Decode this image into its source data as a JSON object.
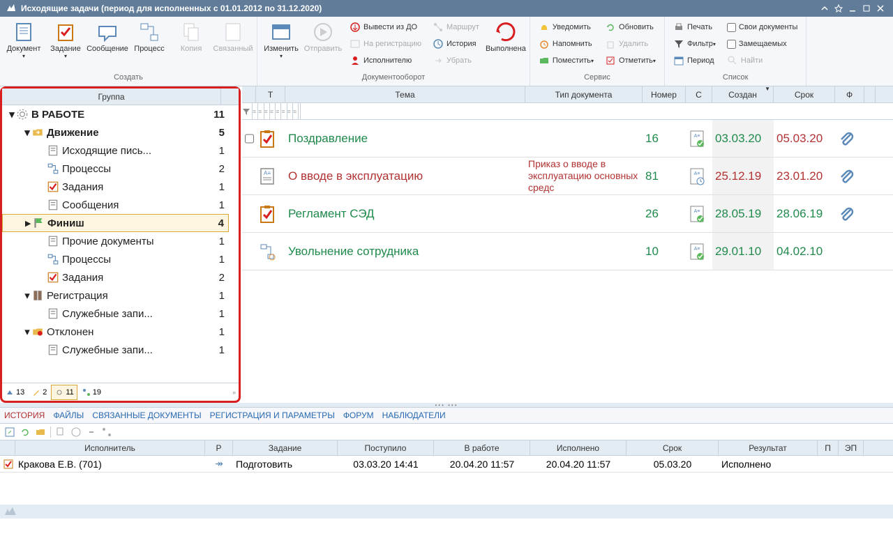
{
  "titlebar": {
    "title": "Исходящие задачи (период для исполненных с 01.01.2012 по 31.12.2020)"
  },
  "ribbon": {
    "group_create_label": "Создать",
    "group_docflow_label": "Документооборот",
    "group_service_label": "Сервис",
    "group_list_label": "Список",
    "document": "Документ",
    "task": "Задание",
    "message": "Сообщение",
    "process": "Процесс",
    "copy": "Копия",
    "related": "Связанный",
    "edit": "Изменить",
    "send": "Отправить",
    "vyvesti": "Вывести из ДО",
    "registration": "На регистрацию",
    "executor": "Исполнителю",
    "route": "Маршрут",
    "history": "История",
    "remove": "Убрать",
    "executed": "Выполнена",
    "notify": "Уведомить",
    "remind": "Напомнить",
    "place": "Поместить ",
    "refresh": "Обновить",
    "delete": "Удалить",
    "mark": "Отметить ",
    "print": "Печать",
    "filter": "Фильтр ",
    "period": "Период",
    "own_docs": "Свои документы",
    "substituted": "Замещаемых",
    "find": "Найти"
  },
  "tree": {
    "header": "Группа",
    "items": [
      {
        "label": "В РАБОТЕ",
        "count": "11",
        "level": 0,
        "bold": true,
        "arrow": "down",
        "icon": "gear"
      },
      {
        "label": "Движение",
        "count": "5",
        "level": 1,
        "bold": true,
        "arrow": "down",
        "icon": "folder-arrow"
      },
      {
        "label": "Исходящие пись...",
        "count": "1",
        "level": 2,
        "arrow": "",
        "icon": "doc"
      },
      {
        "label": "Процессы",
        "count": "2",
        "level": 2,
        "arrow": "",
        "icon": "process"
      },
      {
        "label": "Задания",
        "count": "1",
        "level": 2,
        "arrow": "",
        "icon": "checkbox"
      },
      {
        "label": "Сообщения",
        "count": "1",
        "level": 2,
        "arrow": "",
        "icon": "doc"
      },
      {
        "label": "Финиш",
        "count": "4",
        "level": 1,
        "bold": true,
        "arrow": "right",
        "icon": "flag",
        "selected": true
      },
      {
        "label": "Прочие документы",
        "count": "1",
        "level": 2,
        "arrow": "",
        "icon": "doc"
      },
      {
        "label": "Процессы",
        "count": "1",
        "level": 2,
        "arrow": "",
        "icon": "process"
      },
      {
        "label": "Задания",
        "count": "2",
        "level": 2,
        "arrow": "",
        "icon": "checkbox"
      },
      {
        "label": "Регистрация",
        "count": "1",
        "level": 1,
        "arrow": "down",
        "icon": "book"
      },
      {
        "label": "Служебные запи...",
        "count": "1",
        "level": 2,
        "arrow": "",
        "icon": "doc"
      },
      {
        "label": "Отклонен",
        "count": "1",
        "level": 1,
        "arrow": "down",
        "icon": "folder-x"
      },
      {
        "label": "Служебные запи...",
        "count": "1",
        "level": 2,
        "arrow": "",
        "icon": "doc"
      }
    ],
    "tabs": [
      {
        "count": "13",
        "icon": "outbox"
      },
      {
        "count": "2",
        "icon": "edit"
      },
      {
        "count": "11",
        "icon": "gear",
        "active": true
      },
      {
        "count": "19",
        "icon": "route"
      }
    ]
  },
  "grid": {
    "headers": {
      "c1": "Т",
      "c2": "Тема",
      "c3": "Тип документа",
      "c4": "Номер",
      "c5": "С",
      "c6": "Создан",
      "c7": "Срок",
      "c8": "Ф"
    },
    "rows": [
      {
        "checkbox": true,
        "icon": "check",
        "theme": "Поздравление",
        "theme_color": "green",
        "doctype": "",
        "number": "16",
        "sicon": "ok",
        "created": "03.03.20",
        "created_c": "green",
        "due": "05.03.20",
        "due_c": "red",
        "attach": true
      },
      {
        "icon": "doc",
        "theme": "О вводе в эксплуатацию",
        "theme_color": "red",
        "doctype": "Приказ о вводе в эксплуатацию основных средс",
        "number": "81",
        "sicon": "clock",
        "created": "25.12.19",
        "created_c": "red",
        "due": "23.01.20",
        "due_c": "red",
        "attach": true
      },
      {
        "icon": "check",
        "theme": "Регламент СЭД",
        "theme_color": "green",
        "doctype": "",
        "number": "26",
        "sicon": "ok",
        "created": "28.05.19",
        "created_c": "green",
        "due": "28.06.19",
        "due_c": "green",
        "attach": true
      },
      {
        "icon": "proc",
        "theme": "Увольнение сотрудника",
        "theme_color": "green",
        "doctype": "",
        "number": "10",
        "sicon": "ok",
        "created": "29.01.10",
        "created_c": "green",
        "due": "04.02.10",
        "due_c": "green",
        "attach": false
      }
    ]
  },
  "dtabs": {
    "items": [
      "ИСТОРИЯ",
      "ФАЙЛЫ",
      "СВЯЗАННЫЕ ДОКУМЕНТЫ",
      "РЕГИСТРАЦИЯ И ПАРАМЕТРЫ",
      "ФОРУМ",
      "НАБЛЮДАТЕЛИ"
    ],
    "active": 0
  },
  "dgrid": {
    "headers": {
      "d1": "Исполнитель",
      "d2": "Р",
      "d3": "Задание",
      "d4": "Поступило",
      "d5": "В работе",
      "d6": "Исполнено",
      "d7": "Срок",
      "d8": "Результат",
      "d9": "П",
      "d10": "ЭП"
    },
    "rows": [
      {
        "icon": "check",
        "executor": "Кракова Е.В. (701)",
        "r": "↠",
        "task": "Подготовить",
        "received": "03.03.20 14:41",
        "inwork": "20.04.20 11:57",
        "done": "20.04.20 11:57",
        "due": "05.03.20",
        "result": "Исполнено"
      }
    ]
  }
}
